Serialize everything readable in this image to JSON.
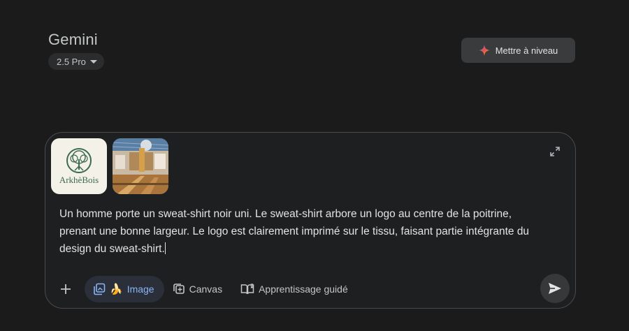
{
  "header": {
    "app_title": "Gemini",
    "model_label": "2.5 Pro",
    "upgrade_label": "Mettre à niveau"
  },
  "composer": {
    "attachments": [
      {
        "kind": "logo",
        "text": "ArkhèBois"
      },
      {
        "kind": "photo",
        "text": ""
      }
    ],
    "prompt": "Un homme porte un sweat-shirt noir uni. Le sweat-shirt arbore un logo au centre de la poitrine, prenant une bonne largeur. Le logo est clairement imprimé sur le tissu, faisant partie intégrante du design du sweat-shirt.",
    "tools": {
      "image_label": "Image",
      "canvas_label": "Canvas",
      "guided_label": "Apprentissage guidé"
    }
  },
  "colors": {
    "background": "#1b1b1c",
    "accent_blue": "#8ab4f8",
    "logo_green": "#3d6b52"
  },
  "icons": [
    "sparkle-icon",
    "expand-icon",
    "plus-icon",
    "image-tool-icon",
    "banana-icon",
    "canvas-icon",
    "guided-learning-icon",
    "send-icon"
  ]
}
